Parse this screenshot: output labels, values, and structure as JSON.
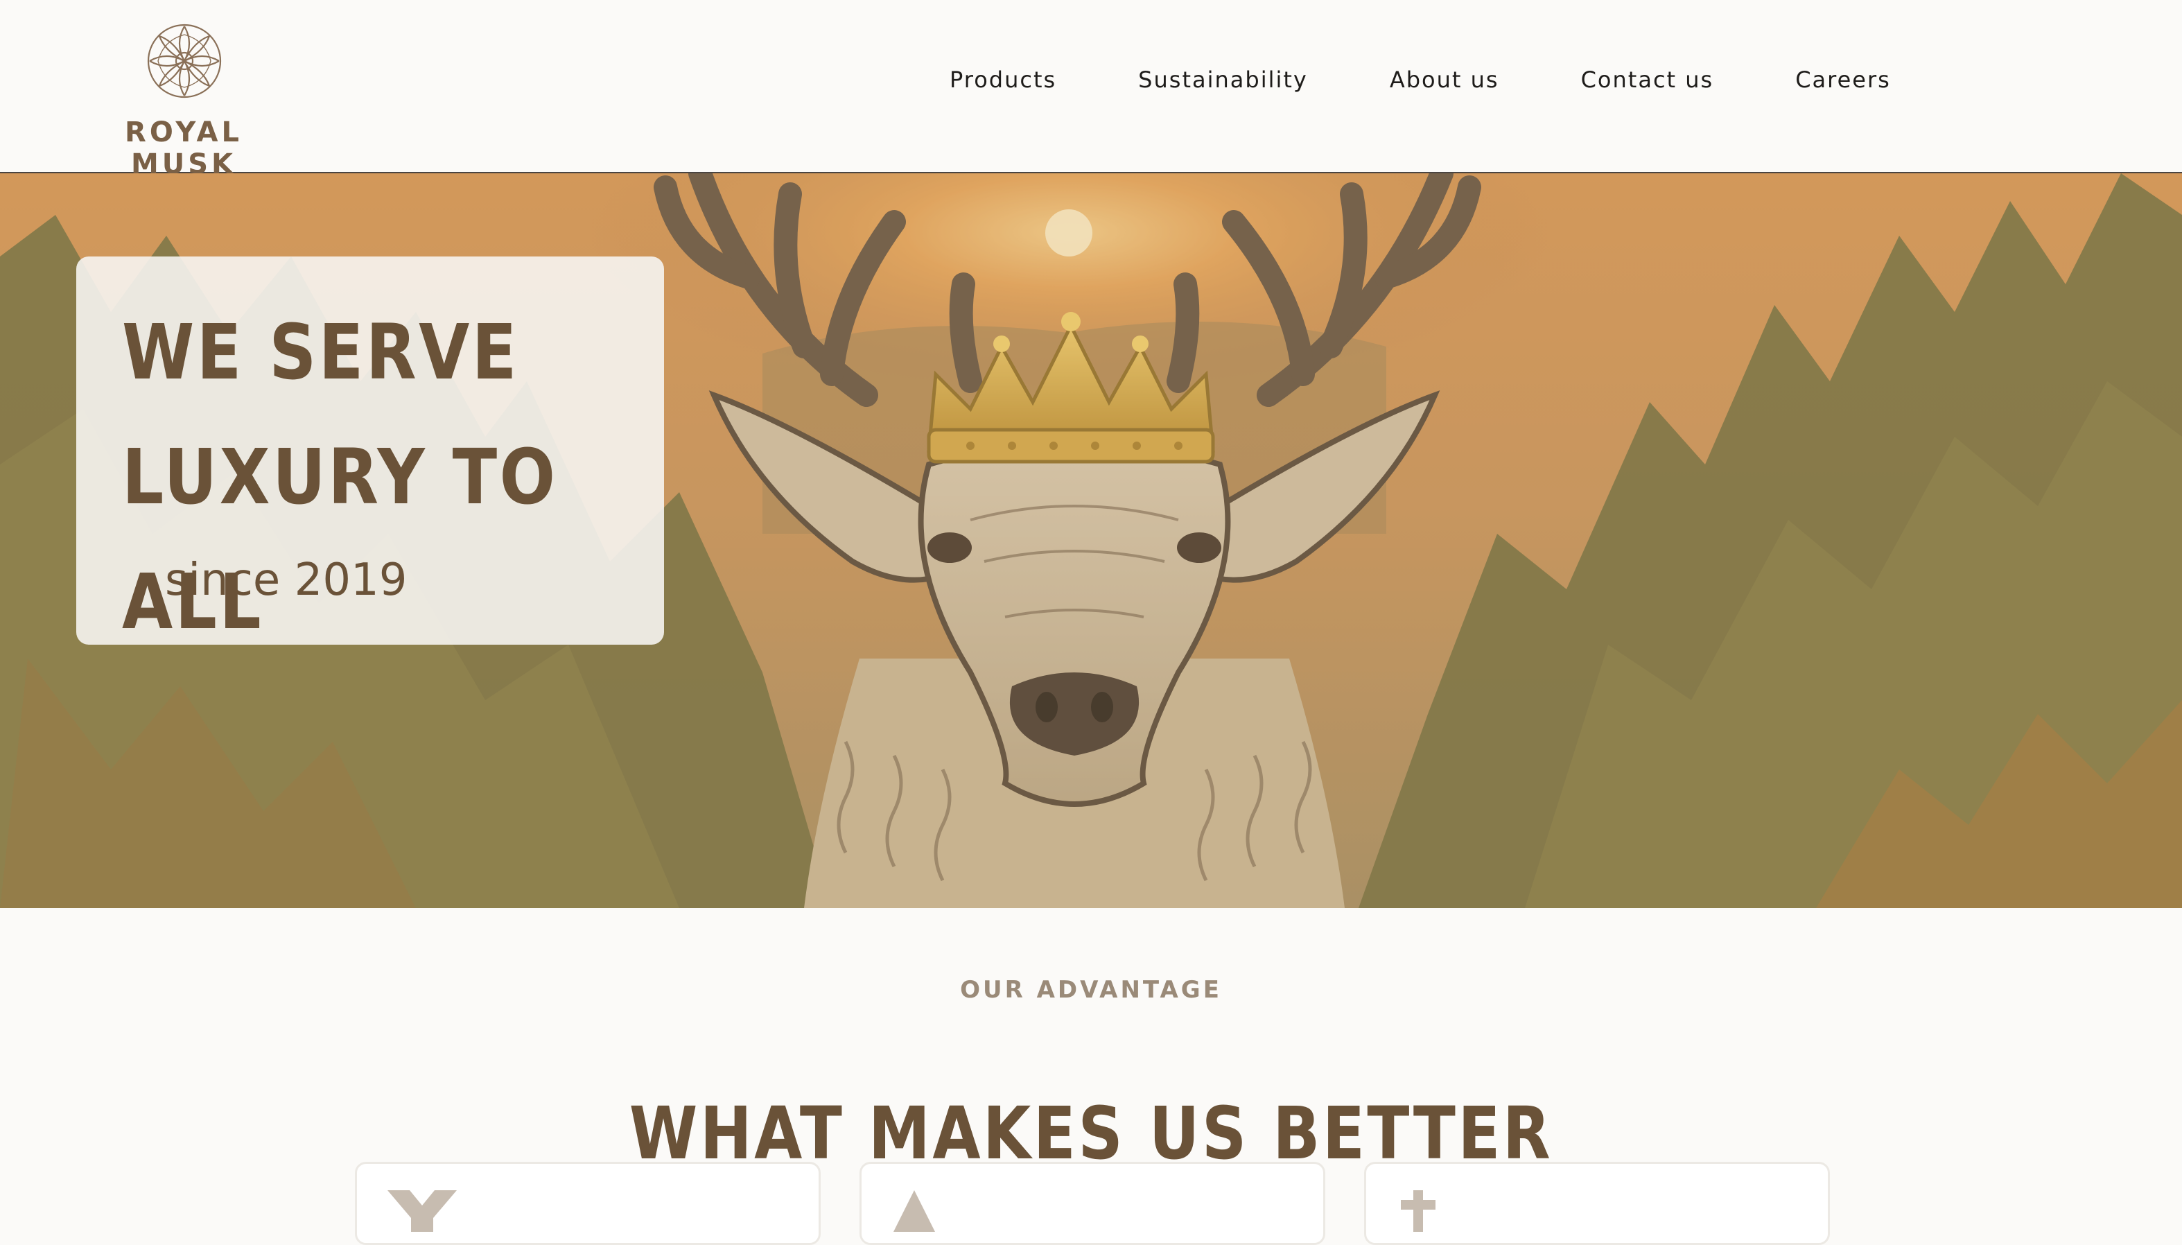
{
  "header": {
    "logo_text": "ROYAL MUSK",
    "nav": [
      {
        "label": "Products"
      },
      {
        "label": "Sustainability"
      },
      {
        "label": "About us"
      },
      {
        "label": "Contact us"
      },
      {
        "label": "Careers"
      }
    ]
  },
  "hero": {
    "headline": "We serve luxury to all",
    "subline": "since 2019",
    "image": "crowned-deer-forest-sunset"
  },
  "advantage": {
    "eyebrow": "OUR ADVANTAGE",
    "title": "WHAT MAKES US BETTER",
    "cards": [
      {
        "icon": "tool-icon"
      },
      {
        "icon": "tree-icon"
      },
      {
        "icon": "plus-icon"
      }
    ]
  },
  "colors": {
    "brand": "#6a5238",
    "logo": "#7a6046",
    "eyebrow": "#9a8a78",
    "background": "#fbfaf8",
    "nav_text": "#1e1c1a"
  }
}
